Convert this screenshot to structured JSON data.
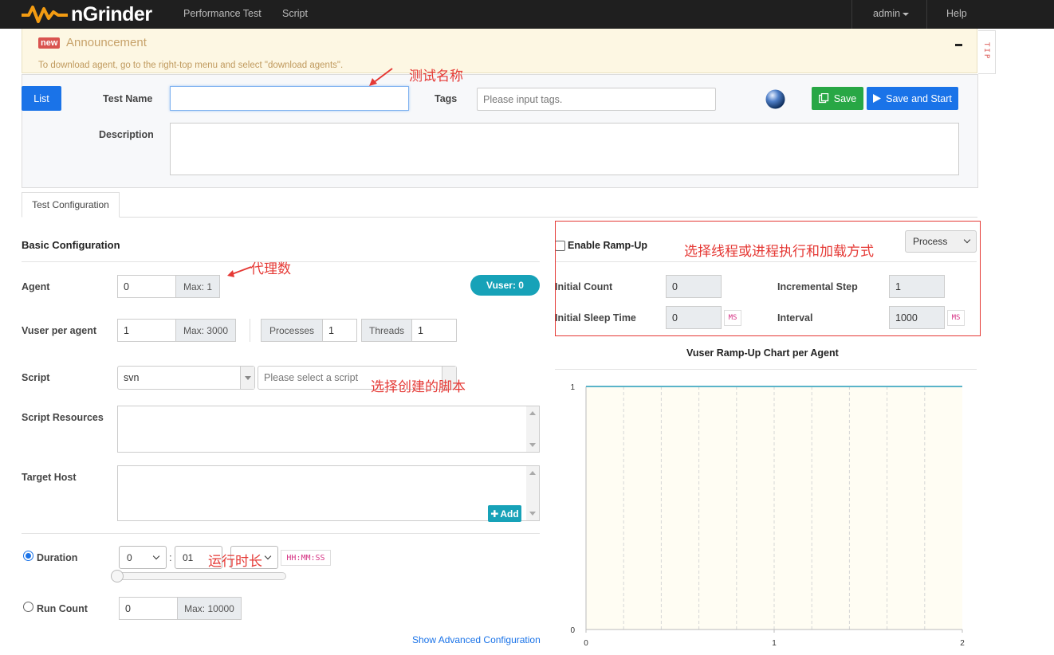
{
  "nav": {
    "brand": "nGrinder",
    "links": [
      "Performance Test",
      "Script"
    ],
    "user": "admin",
    "help": "Help"
  },
  "announcement": {
    "badge": "new",
    "title": "Announcement",
    "message": "To download agent, go to the right-top menu and select \"download agents\".",
    "tip": "TIP"
  },
  "form": {
    "list_button": "List",
    "test_name_label": "Test Name",
    "test_name_value": "",
    "tags_label": "Tags",
    "tags_placeholder": "Please input tags.",
    "save_button": "Save",
    "save_start_button": "Save and Start",
    "description_label": "Description",
    "description_value": ""
  },
  "tabs": {
    "config": "Test Configuration"
  },
  "basic": {
    "heading": "Basic Configuration",
    "agent_label": "Agent",
    "agent_value": "0",
    "agent_max": "Max: 1",
    "vuser_badge": "Vuser: 0",
    "vuser_label": "Vuser per agent",
    "vuser_value": "1",
    "vuser_max": "Max: 3000",
    "processes_label": "Processes",
    "processes_value": "1",
    "threads_label": "Threads",
    "threads_value": "1",
    "script_label": "Script",
    "script_repo": "svn",
    "script_placeholder": "Please select a script",
    "resources_label": "Script Resources",
    "target_label": "Target Host",
    "add_button": "Add",
    "duration_label": "Duration",
    "duration_hours": "0",
    "duration_minutes": "01",
    "duration_format": "HH:MM:SS",
    "duration_colon": ":",
    "duration_slider": 0,
    "runcount_label": "Run Count",
    "runcount_value": "0",
    "runcount_max": "Max: 10000",
    "advanced_link": "Show Advanced Configuration"
  },
  "rampup": {
    "enable_label": "Enable Ramp-Up",
    "enabled": false,
    "mode": "Process",
    "initial_count_label": "Initial Count",
    "initial_count": "0",
    "incremental_step_label": "Incremental Step",
    "incremental_step": "1",
    "initial_sleep_label": "Initial Sleep Time",
    "initial_sleep": "0",
    "interval_label": "Interval",
    "interval": "1000",
    "ms": "MS",
    "chart_title": "Vuser Ramp-Up Chart per Agent"
  },
  "annotations": {
    "test_name": "测试名称",
    "agents": "代理数",
    "thread_mode": "选择线程或进程执行和加载方式",
    "script": "选择创建的脚本",
    "duration": "运行时长"
  },
  "colors": {
    "primary": "#1a73e8",
    "success": "#28a745",
    "info": "#17a2b8",
    "annotation": "#e53935"
  },
  "chart_data": {
    "type": "line",
    "title": "Vuser Ramp-Up Chart per Agent",
    "x": [
      0,
      2
    ],
    "series": [
      {
        "values": [
          1,
          1
        ]
      }
    ],
    "xlim": [
      0,
      2
    ],
    "ylim": [
      0,
      1
    ],
    "xticks": [
      "0",
      "1",
      "2"
    ],
    "yticks": [
      "0",
      "1"
    ],
    "grid": true
  }
}
